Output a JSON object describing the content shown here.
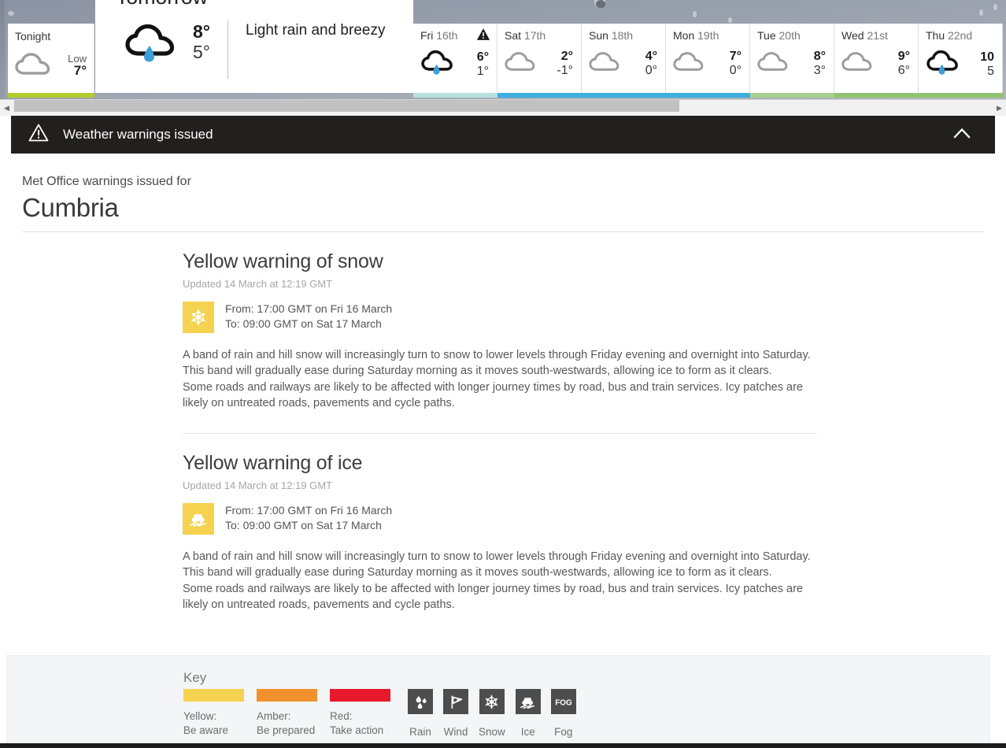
{
  "forecast": {
    "tonight": {
      "label": "Tonight",
      "icon": "cloud-icon",
      "low_word": "Low",
      "low_temp": "7°",
      "bar_color": "#b5ca2c"
    },
    "tomorrow": {
      "title": "Tomorrow",
      "warning_icon": "warning-triangle-icon",
      "icon": "rain-cloud-icon",
      "high_temp": "8°",
      "low_temp": "5°",
      "description": "Light rain and breezy"
    },
    "days": [
      {
        "dow": "Fri",
        "dnum": "16th",
        "icon": "rain-cloud-icon",
        "high": "6°",
        "low": "1°",
        "warning": true,
        "bar_color": "#b9dfe0"
      },
      {
        "dow": "Sat",
        "dnum": "17th",
        "icon": "cloud-icon",
        "high": "2°",
        "low": "-1°",
        "warning": false,
        "bar_color": "#3eaee0"
      },
      {
        "dow": "Sun",
        "dnum": "18th",
        "icon": "cloud-icon",
        "high": "4°",
        "low": "0°",
        "warning": false,
        "bar_color": "#3eaee0"
      },
      {
        "dow": "Mon",
        "dnum": "19th",
        "icon": "cloud-icon",
        "high": "7°",
        "low": "0°",
        "warning": false,
        "bar_color": "#3eaee0"
      },
      {
        "dow": "Tue",
        "dnum": "20th",
        "icon": "cloud-icon",
        "high": "8°",
        "low": "3°",
        "warning": false,
        "bar_color": "#a7cf8f"
      },
      {
        "dow": "Wed",
        "dnum": "21st",
        "icon": "cloud-icon",
        "high": "9°",
        "low": "6°",
        "warning": false,
        "bar_color": "#91c46f"
      },
      {
        "dow": "Thu",
        "dnum": "22nd",
        "icon": "rain-cloud-icon",
        "high": "10",
        "low": "5",
        "warning": false,
        "bar_color": "#91c46f"
      }
    ],
    "scrollbar": {
      "left_arrow": "◀",
      "right_arrow": "▶"
    }
  },
  "banner": {
    "icon": "warning-triangle-icon",
    "title": "Weather warnings issued",
    "collapse_icon": "chevron-up-icon"
  },
  "intro": {
    "label": "Met Office warnings issued for",
    "region": "Cumbria"
  },
  "warnings": [
    {
      "title": "Yellow warning of snow",
      "updated": "Updated 14 March at 12:19 GMT",
      "badge_icon": "snowflake-icon",
      "badge_color": "#f5d24f",
      "from": "From: 17:00 GMT on Fri 16 March",
      "to": "To: 09:00 GMT on Sat 17 March",
      "body_1": "A band of rain and hill snow will increasingly turn to snow to lower levels through Friday evening and overnight into Saturday. This band will gradually ease during Saturday morning as it moves south-westwards, allowing ice to form as it clears.",
      "body_2": "Some roads and railways are likely to be affected with longer journey times by road, bus and train services. Icy patches are likely on untreated roads, pavements and cycle paths."
    },
    {
      "title": "Yellow warning of ice",
      "updated": "Updated 14 March at 12:19 GMT",
      "badge_icon": "ice-car-icon",
      "badge_color": "#f5d24f",
      "from": "From: 17:00 GMT on Fri 16 March",
      "to": "To: 09:00 GMT on Sat 17 March",
      "body_1": "A band of rain and hill snow will increasingly turn to snow to lower levels through Friday evening and overnight into Saturday. This band will gradually ease during Saturday morning as it moves south-westwards, allowing ice to form as it clears.",
      "body_2": "Some roads and railways are likely to be affected with longer journey times by road, bus and train services. Icy patches are likely on untreated roads, pavements and cycle paths."
    }
  ],
  "key": {
    "title": "Key",
    "levels": [
      {
        "label": "Yellow:\nBe aware",
        "color": "#f5d24f"
      },
      {
        "label": "Amber:\nBe prepared",
        "color": "#f0912d"
      },
      {
        "label": "Red:\nTake action",
        "color": "#e8192c"
      }
    ],
    "types": [
      {
        "label": "Rain",
        "icon": "rain-drops-icon"
      },
      {
        "label": "Wind",
        "icon": "wind-flag-icon"
      },
      {
        "label": "Snow",
        "icon": "snowflake-icon"
      },
      {
        "label": "Ice",
        "icon": "ice-car-icon"
      },
      {
        "label": "Fog",
        "icon": "fog-text-icon"
      }
    ]
  }
}
